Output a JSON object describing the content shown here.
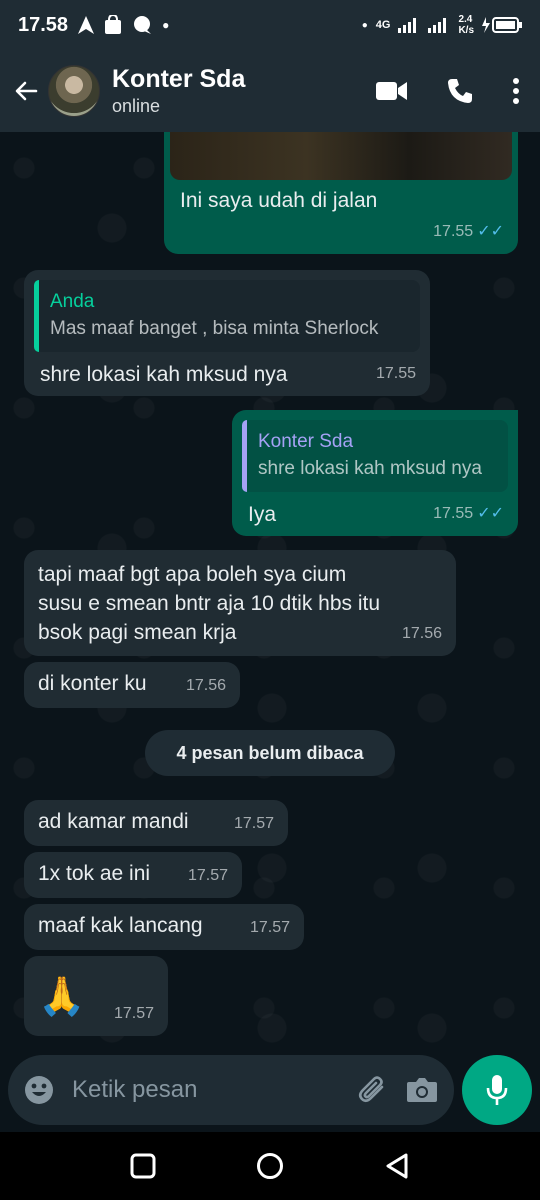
{
  "status_bar": {
    "time": "17.58",
    "network": "4G",
    "speed_value": "2.4",
    "speed_unit": "K/s"
  },
  "header": {
    "contact_name": "Konter Sda",
    "contact_status": "online"
  },
  "messages": [
    {
      "dir": "out",
      "text": "Ini saya udah di jalan",
      "time": "17.55",
      "read": true
    },
    {
      "dir": "in",
      "quote_name": "Anda",
      "quote_text": "Mas maaf banget , bisa minta Sherlock",
      "text": "shre lokasi kah mksud nya",
      "time": "17.55"
    },
    {
      "dir": "out",
      "quote_name": "Konter Sda",
      "quote_text": "shre lokasi kah mksud nya",
      "text": "Iya",
      "time": "17.55",
      "read": true
    },
    {
      "dir": "in",
      "text_lines": [
        "tapi maaf bgt apa boleh sya cium",
        "susu e smean bntr aja 10 dtik hbs itu",
        "bsok pagi smean krja"
      ],
      "time": "17.56"
    },
    {
      "dir": "in",
      "text": "di konter ku",
      "time": "17.56"
    },
    {
      "dir": "in",
      "text": "ad kamar mandi",
      "time": "17.57"
    },
    {
      "dir": "in",
      "text": "1x tok ae ini",
      "time": "17.57"
    },
    {
      "dir": "in",
      "text": "maaf kak lancang",
      "time": "17.57"
    },
    {
      "dir": "in",
      "text": "🙏",
      "time": "17.57"
    }
  ],
  "unread_banner": "4 pesan belum dibaca",
  "composer": {
    "placeholder": "Ketik pesan"
  },
  "colors": {
    "incoming_bubble": "#202c33",
    "outgoing_bubble": "#005c4b",
    "accent": "#00a884",
    "read_ticks": "#53bdeb"
  },
  "icons": [
    "back-arrow-icon",
    "video-call-icon",
    "phone-icon",
    "more-icon",
    "emoji-icon",
    "attach-icon",
    "camera-icon",
    "mic-icon",
    "nav-recents-icon",
    "nav-home-icon",
    "nav-back-icon"
  ]
}
